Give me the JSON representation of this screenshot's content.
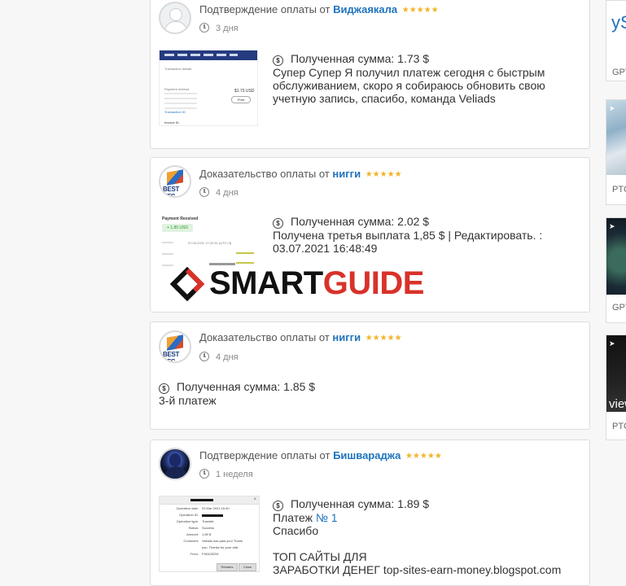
{
  "watermark": {
    "part1": "SMART",
    "part2": "GUIDE"
  },
  "sidebar": [
    {
      "title": "yS",
      "caption": "GPT"
    },
    {
      "title": "",
      "caption": "PTC"
    },
    {
      "title": "",
      "caption": "GPT"
    },
    {
      "title": "view",
      "caption": "PTC"
    }
  ],
  "cards": [
    {
      "prefix": "Подтверждение оплаты от",
      "user": "Виджаякала",
      "time": "3 дня",
      "amount": "Полученная сумма: 1.73 $",
      "lines": [
        "Супер Супер Я получил платеж сегодня с быстрым",
        "обслуживанием, скоро я собираюсь обновить свою",
        "учетную запись, спасибо, команда Veliads"
      ],
      "thumb": {
        "label1": "Transaction details",
        "label2": "Payment method",
        "amount": "$1.73 USD",
        "btn": "Print",
        "footer1": "Transaction ID",
        "footer2": "Invoice ID"
      }
    },
    {
      "prefix": "Доказательство оплаты от",
      "user": "нигги",
      "time": "4 дня",
      "amount": "Полученная сумма: 2.02 $",
      "lines": [
        "Получена третья выплата 1,85 $ | Редактировать. :",
        "03.07.2021 16:48:49"
      ],
      "thumb": {
        "title": "Payment Received",
        "badge": "+ 1.85 USD",
        "date": "07.03.2021 17:22:31 (UTC+3)"
      }
    },
    {
      "prefix": "Доказательство оплаты от",
      "user": "нигги",
      "time": "4 дня",
      "amount": "Полученная сумма: 1.85 $",
      "lines": [
        "3-й платеж"
      ]
    },
    {
      "prefix": "Подтверждение оплаты от",
      "user": "Бишвараджа",
      "time": "1 неделя",
      "amount": "Полученная сумма: 1.89 $",
      "line_payment_prefix": "Платеж",
      "line_payment_link": "№ 1",
      "lines": [
        "Спасибо",
        "",
        "ТОП САЙТЫ ДЛЯ",
        "ЗАРАБОТКИ ДЕНЕГ top-sites-earn-money.blogspot.com"
      ],
      "thumb": {
        "rows": [
          [
            "Operation date:",
            "03 Mar 2021 16:40"
          ],
          [
            "Operation ID:",
            ""
          ],
          [
            "Operation type:",
            "Transfer"
          ],
          [
            "Status:",
            "Success"
          ],
          [
            "Amount:",
            "1.89 $"
          ],
          [
            "Comment:",
            "Veliads has paid you! Thank"
          ],
          [
            "",
            "you. Thanks for your visit."
          ],
          [
            "From:",
            "P40428234"
          ]
        ],
        "btn1": "Rebates",
        "btn2": "Close"
      }
    }
  ],
  "stars": "★★★★★"
}
